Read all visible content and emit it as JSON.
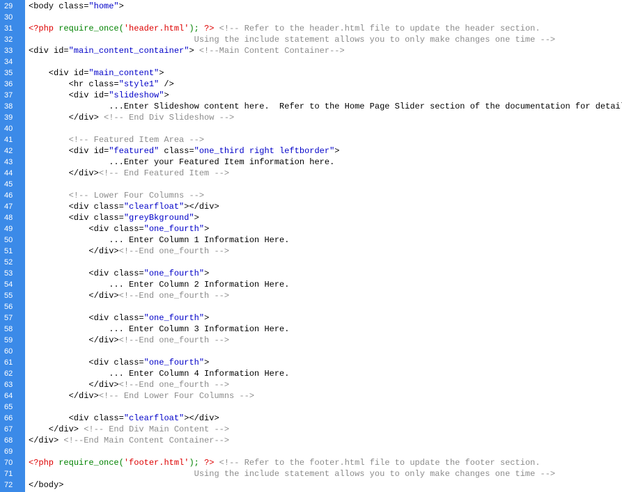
{
  "editor": {
    "colors": {
      "gutter_bg": "#3b8ae8",
      "line_number": "#ffffff",
      "plain": "#000000",
      "attr_value": "#0000c8",
      "comment": "#8c8c8c",
      "php_delim": "#dd0000",
      "php_code": "#008200",
      "php_string": "#dd0000"
    },
    "lines": [
      {
        "num": "29",
        "tokens": [
          {
            "t": "<body class=",
            "c": "plain"
          },
          {
            "t": "\"home\"",
            "c": "attr_value"
          },
          {
            "t": ">",
            "c": "plain"
          }
        ]
      },
      {
        "num": "30",
        "tokens": []
      },
      {
        "num": "31",
        "tokens": [
          {
            "t": "<?php",
            "c": "php_delim"
          },
          {
            "t": " require_once(",
            "c": "php_code"
          },
          {
            "t": "'header.html'",
            "c": "php_string"
          },
          {
            "t": "); ",
            "c": "php_code"
          },
          {
            "t": "?>",
            "c": "php_delim"
          },
          {
            "t": " <!-- Refer to the header.html file to update the header section.",
            "c": "comment"
          }
        ]
      },
      {
        "num": "32",
        "tokens": [
          {
            "t": "                                 Using the include statement allows you to only make changes one time -->",
            "c": "comment"
          }
        ]
      },
      {
        "num": "33",
        "tokens": [
          {
            "t": "<div id=",
            "c": "plain"
          },
          {
            "t": "\"main_content_container\"",
            "c": "attr_value"
          },
          {
            "t": "> ",
            "c": "plain"
          },
          {
            "t": "<!--Main Content Container-->",
            "c": "comment"
          }
        ]
      },
      {
        "num": "34",
        "tokens": []
      },
      {
        "num": "35",
        "tokens": [
          {
            "t": "    <div id=",
            "c": "plain"
          },
          {
            "t": "\"main_content\"",
            "c": "attr_value"
          },
          {
            "t": ">",
            "c": "plain"
          }
        ]
      },
      {
        "num": "36",
        "tokens": [
          {
            "t": "        <hr class=",
            "c": "plain"
          },
          {
            "t": "\"style1\"",
            "c": "attr_value"
          },
          {
            "t": " />",
            "c": "plain"
          }
        ]
      },
      {
        "num": "37",
        "tokens": [
          {
            "t": "        <div id=",
            "c": "plain"
          },
          {
            "t": "\"slideshow\"",
            "c": "attr_value"
          },
          {
            "t": ">",
            "c": "plain"
          }
        ]
      },
      {
        "num": "38",
        "tokens": [
          {
            "t": "                ...Enter Slideshow content here.  Refer to the Home Page Slider section of the documentation for details.",
            "c": "plain"
          }
        ]
      },
      {
        "num": "39",
        "tokens": [
          {
            "t": "        </div> ",
            "c": "plain"
          },
          {
            "t": "<!-- End Div Slideshow -->",
            "c": "comment"
          }
        ]
      },
      {
        "num": "40",
        "tokens": []
      },
      {
        "num": "41",
        "tokens": [
          {
            "t": "        <!-- Featured Item Area -->",
            "c": "comment"
          }
        ]
      },
      {
        "num": "42",
        "tokens": [
          {
            "t": "        <div id=",
            "c": "plain"
          },
          {
            "t": "\"featured\"",
            "c": "attr_value"
          },
          {
            "t": " class=",
            "c": "plain"
          },
          {
            "t": "\"one_third right leftborder\"",
            "c": "attr_value"
          },
          {
            "t": ">",
            "c": "plain"
          }
        ]
      },
      {
        "num": "43",
        "tokens": [
          {
            "t": "                ...Enter your Featured Item information here.",
            "c": "plain"
          }
        ]
      },
      {
        "num": "44",
        "tokens": [
          {
            "t": "        </div>",
            "c": "plain"
          },
          {
            "t": "<!-- End Featured Item -->",
            "c": "comment"
          }
        ]
      },
      {
        "num": "45",
        "tokens": []
      },
      {
        "num": "46",
        "tokens": [
          {
            "t": "        <!-- Lower Four Columns -->",
            "c": "comment"
          }
        ]
      },
      {
        "num": "47",
        "tokens": [
          {
            "t": "        <div class=",
            "c": "plain"
          },
          {
            "t": "\"clearfloat\"",
            "c": "attr_value"
          },
          {
            "t": "></div>",
            "c": "plain"
          }
        ]
      },
      {
        "num": "48",
        "tokens": [
          {
            "t": "        <div class=",
            "c": "plain"
          },
          {
            "t": "\"greyBkground\"",
            "c": "attr_value"
          },
          {
            "t": ">",
            "c": "plain"
          }
        ]
      },
      {
        "num": "49",
        "tokens": [
          {
            "t": "            <div class=",
            "c": "plain"
          },
          {
            "t": "\"one_fourth\"",
            "c": "attr_value"
          },
          {
            "t": ">",
            "c": "plain"
          }
        ]
      },
      {
        "num": "50",
        "tokens": [
          {
            "t": "                ... Enter Column 1 Information Here.",
            "c": "plain"
          }
        ]
      },
      {
        "num": "51",
        "tokens": [
          {
            "t": "            </div>",
            "c": "plain"
          },
          {
            "t": "<!--End one_fourth -->",
            "c": "comment"
          }
        ]
      },
      {
        "num": "52",
        "tokens": []
      },
      {
        "num": "53",
        "tokens": [
          {
            "t": "            <div class=",
            "c": "plain"
          },
          {
            "t": "\"one_fourth\"",
            "c": "attr_value"
          },
          {
            "t": ">",
            "c": "plain"
          }
        ]
      },
      {
        "num": "54",
        "tokens": [
          {
            "t": "                ... Enter Column 2 Information Here.",
            "c": "plain"
          }
        ]
      },
      {
        "num": "55",
        "tokens": [
          {
            "t": "            </div>",
            "c": "plain"
          },
          {
            "t": "<!--End one_fourth -->",
            "c": "comment"
          }
        ]
      },
      {
        "num": "56",
        "tokens": []
      },
      {
        "num": "57",
        "tokens": [
          {
            "t": "            <div class=",
            "c": "plain"
          },
          {
            "t": "\"one_fourth\"",
            "c": "attr_value"
          },
          {
            "t": ">",
            "c": "plain"
          }
        ]
      },
      {
        "num": "58",
        "tokens": [
          {
            "t": "                ... Enter Column 3 Information Here.",
            "c": "plain"
          }
        ]
      },
      {
        "num": "59",
        "tokens": [
          {
            "t": "            </div>",
            "c": "plain"
          },
          {
            "t": "<!--End one_fourth -->",
            "c": "comment"
          }
        ]
      },
      {
        "num": "60",
        "tokens": []
      },
      {
        "num": "61",
        "tokens": [
          {
            "t": "            <div class=",
            "c": "plain"
          },
          {
            "t": "\"one_fourth\"",
            "c": "attr_value"
          },
          {
            "t": ">",
            "c": "plain"
          }
        ]
      },
      {
        "num": "62",
        "tokens": [
          {
            "t": "                ... Enter Column 4 Information Here.",
            "c": "plain"
          }
        ]
      },
      {
        "num": "63",
        "tokens": [
          {
            "t": "            </div>",
            "c": "plain"
          },
          {
            "t": "<!--End one_fourth -->",
            "c": "comment"
          }
        ]
      },
      {
        "num": "64",
        "tokens": [
          {
            "t": "        </div>",
            "c": "plain"
          },
          {
            "t": "<!-- End Lower Four Columns -->",
            "c": "comment"
          }
        ]
      },
      {
        "num": "65",
        "tokens": []
      },
      {
        "num": "66",
        "tokens": [
          {
            "t": "        <div class=",
            "c": "plain"
          },
          {
            "t": "\"clearfloat\"",
            "c": "attr_value"
          },
          {
            "t": "></div>",
            "c": "plain"
          }
        ]
      },
      {
        "num": "67",
        "tokens": [
          {
            "t": "    </div> ",
            "c": "plain"
          },
          {
            "t": "<!-- End Div Main Content -->",
            "c": "comment"
          }
        ]
      },
      {
        "num": "68",
        "tokens": [
          {
            "t": "</div> ",
            "c": "plain"
          },
          {
            "t": "<!--End Main Content Container-->",
            "c": "comment"
          }
        ]
      },
      {
        "num": "69",
        "tokens": []
      },
      {
        "num": "70",
        "tokens": [
          {
            "t": "<?php",
            "c": "php_delim"
          },
          {
            "t": " require_once(",
            "c": "php_code"
          },
          {
            "t": "'footer.html'",
            "c": "php_string"
          },
          {
            "t": "); ",
            "c": "php_code"
          },
          {
            "t": "?>",
            "c": "php_delim"
          },
          {
            "t": " <!-- Refer to the footer.html file to update the footer section.",
            "c": "comment"
          }
        ]
      },
      {
        "num": "71",
        "tokens": [
          {
            "t": "                                 Using the include statement allows you to only make changes one time -->",
            "c": "comment"
          }
        ]
      },
      {
        "num": "72",
        "tokens": [
          {
            "t": "</body>",
            "c": "plain"
          }
        ]
      }
    ]
  }
}
